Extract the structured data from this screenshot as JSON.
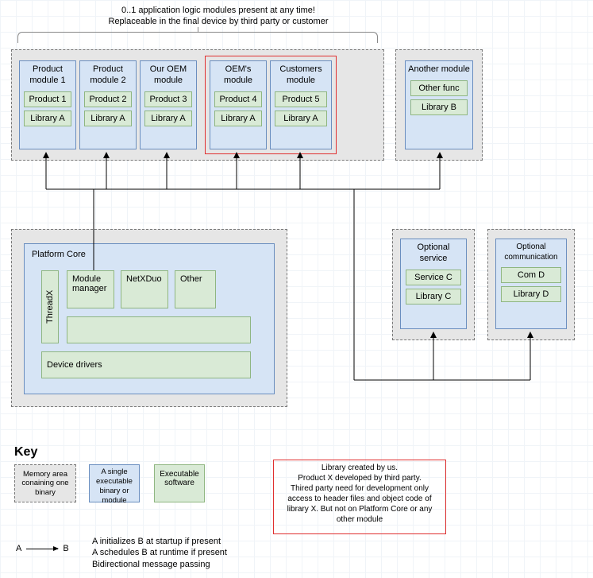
{
  "note": {
    "line1": "0..1 application logic modules present at any time!",
    "line2": "Replaceable in the final device by third party or customer"
  },
  "modules": [
    {
      "title": "Product module 1",
      "box1": "Product 1",
      "box2": "Library A"
    },
    {
      "title": "Product module 2",
      "box1": "Product 2",
      "box2": "Library A"
    },
    {
      "title": "Our OEM module",
      "box1": "Product 3",
      "box2": "Library A"
    },
    {
      "title": "OEM's module",
      "box1": "Product 4",
      "box2": "Library A"
    },
    {
      "title": "Customers module",
      "box1": "Product 5",
      "box2": "Library A"
    }
  ],
  "anotherModule": {
    "title": "Another module",
    "box1": "Other func",
    "box2": "Library B"
  },
  "platformCore": {
    "title": "Platform Core",
    "threadx": "ThreadX",
    "moduleManager": "Module manager",
    "netxduo": "NetXDuo",
    "other": "Other",
    "deviceDrivers": "Device drivers"
  },
  "optionalService": {
    "title": "Optional service",
    "box1": "Service C",
    "box2": "Library C"
  },
  "optionalComm": {
    "title": "Optional communication",
    "box1": "Com D",
    "box2": "Library D"
  },
  "key": {
    "title": "Key",
    "mem": "Memory area conaining one binary",
    "bin": "A single executable binary or module",
    "exe": "Executable software",
    "redtext": "Library created by us.\nProduct X developed by third party.\nThired party need for development only access to header files and object code of library X. But not on Platform Core or any other module",
    "A": "A",
    "B": "B",
    "rel1": "A initializes B at startup if present",
    "rel2": "A schedules B at runtime if present",
    "rel3": "Bidirectional message passing"
  }
}
